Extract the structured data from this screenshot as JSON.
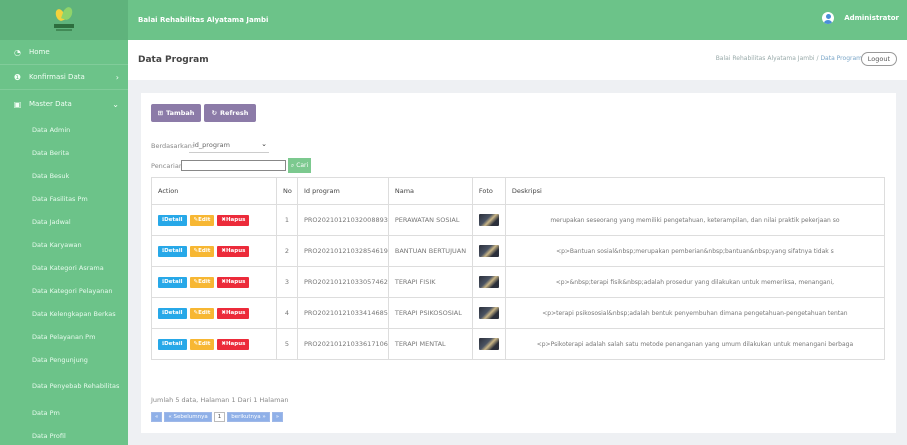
{
  "brand": "Balai Rehabilitas Alyatama Jambi",
  "user": "Administrator",
  "page": {
    "title": "Data Program",
    "breadcrumb": [
      "Balai Rehabilitas Alyatama Jambi",
      "Data Program"
    ],
    "logout": "Logout"
  },
  "sidebar": {
    "home": "Home",
    "konfirmasi": "Konfirmasi Data",
    "master": "Master Data",
    "items": [
      "Data Admin",
      "Data Berita",
      "Data Besuk",
      "Data Fasilitas Pm",
      "Data Jadwal",
      "Data Karyawan",
      "Data Kategori Asrama",
      "Data Kategori Pelayanan",
      "Data Kelengkapan Berkas",
      "Data Pelayanan Pm",
      "Data Pengunjung",
      "Data Penyebab Rehabilitas",
      "Data Pm",
      "Data Profil"
    ]
  },
  "toolbar": {
    "tambah": "Tambah",
    "refresh": "Refresh"
  },
  "filter": {
    "berdasarkan_label": "Berdasarkan:",
    "berdasarkan_value": "id_program",
    "pencarian_label": "Pencarian:",
    "cari": "Cari"
  },
  "table": {
    "headers": [
      "Action",
      "No",
      "Id program",
      "Nama",
      "Foto",
      "Deskripsi"
    ],
    "actions": {
      "detail": "Detail",
      "edit": "Edit",
      "hapus": "Hapus"
    },
    "rows": [
      {
        "no": "1",
        "id": "PRO20210121032008893",
        "nama": "PERAWATAN SOSIAL",
        "desc": "merupakan seseorang yang memiliki pengetahuan, keterampilan, dan nilai praktik pekerjaan so"
      },
      {
        "no": "2",
        "id": "PRO20210121032854619",
        "nama": "BANTUAN BERTUJUAN",
        "desc": "<p>Bantuan sosial&nbsp;merupakan pemberian&nbsp;bantuan&nbsp;yang sifatnya tidak s"
      },
      {
        "no": "3",
        "id": "PRO20210121033057462",
        "nama": "TERAPI FISIK",
        "desc": "<p>&nbsp;terapi fisik&nbsp;adalah prosedur yang dilakukan untuk memeriksa, menangani,"
      },
      {
        "no": "4",
        "id": "PRO20210121033414685",
        "nama": "TERAPI PSIKOSOSIAL",
        "desc": "<p>terapi psikososial&nbsp;adalah bentuk penyembuhan dimana pengetahuan-pengetahuan tentan"
      },
      {
        "no": "5",
        "id": "PRO20210121033617106",
        "nama": "TERAPI MENTAL",
        "desc": "<p>Psikoterapi adalah salah satu metode penanganan yang umum dilakukan untuk menangani berbaga"
      }
    ]
  },
  "summary": "Jumlah 5 data, Halaman 1 Dari 1 Halaman",
  "pager": {
    "first": "«",
    "prev": "« Sebelumnya",
    "current": "1",
    "next": "berikutnya »",
    "last": "»"
  }
}
